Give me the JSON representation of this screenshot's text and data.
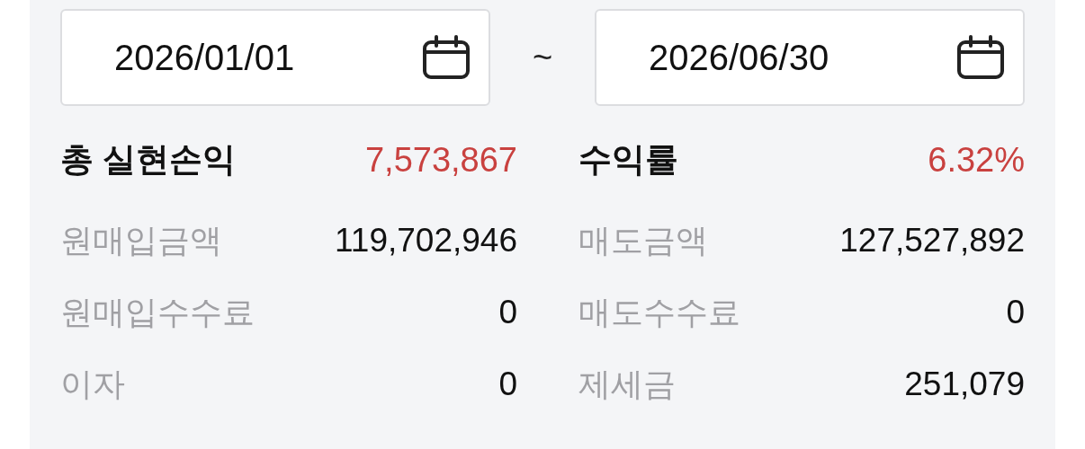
{
  "date_range": {
    "start": "2026/01/01",
    "separator": "~",
    "end": "2026/06/30"
  },
  "columns": [
    {
      "items": [
        {
          "kind": "total",
          "label": "총 실현손익",
          "value": "7,573,867"
        },
        {
          "kind": "detail",
          "label": "원매입금액",
          "value": "119,702,946"
        },
        {
          "kind": "detail",
          "label": "원매입수수료",
          "value": "0"
        },
        {
          "kind": "detail",
          "label": "이자",
          "value": "0"
        }
      ]
    },
    {
      "items": [
        {
          "kind": "total",
          "label": "수익률",
          "value": "6.32%"
        },
        {
          "kind": "detail",
          "label": "매도금액",
          "value": "127,527,892"
        },
        {
          "kind": "detail",
          "label": "매도수수료",
          "value": "0"
        },
        {
          "kind": "detail",
          "label": "제세금",
          "value": "251,079"
        }
      ]
    }
  ]
}
